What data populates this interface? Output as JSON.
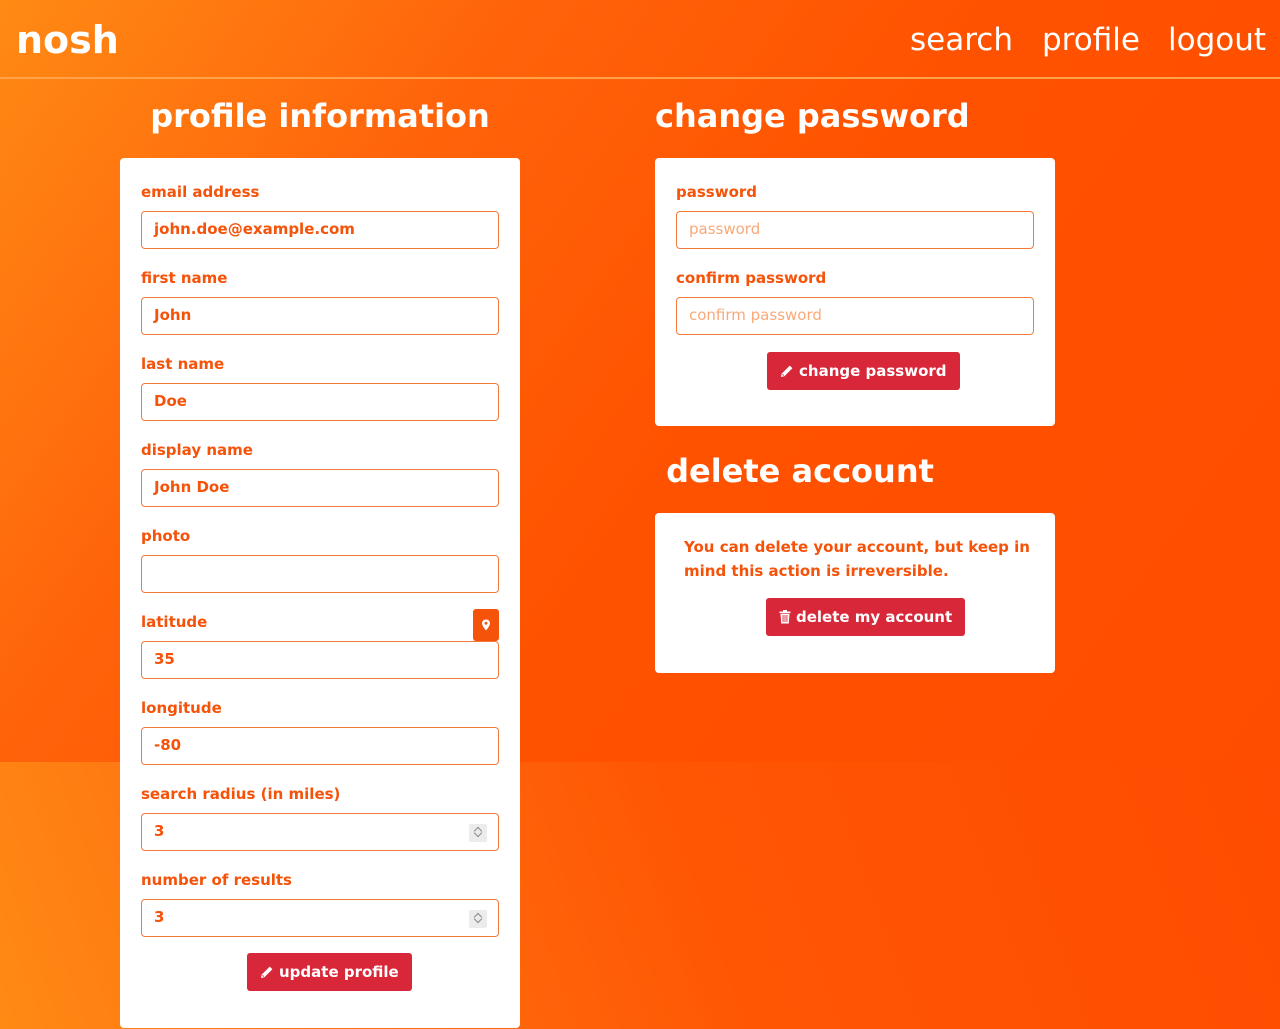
{
  "app": {
    "brand": "nosh"
  },
  "nav": {
    "search": "search",
    "profile": "profile",
    "logout": "logout"
  },
  "profile_section": {
    "title": "profile information",
    "email_label": "email address",
    "email_value": "john.doe@example.com",
    "first_name_label": "first name",
    "first_name_value": "John",
    "last_name_label": "last name",
    "last_name_value": "Doe",
    "display_name_label": "display name",
    "display_name_value": "John Doe",
    "photo_label": "photo",
    "photo_value": "",
    "latitude_label": "latitude",
    "latitude_value": "35",
    "longitude_label": "longitude",
    "longitude_value": "-80",
    "radius_label": "search radius (in miles)",
    "radius_value": "3",
    "results_label": "number of results",
    "results_value": "3",
    "update_button": "update profile"
  },
  "password_section": {
    "title": "change password",
    "password_label": "password",
    "password_placeholder": "password",
    "confirm_label": "confirm password",
    "confirm_placeholder": "confirm password",
    "change_button": "change password"
  },
  "delete_section": {
    "title": "delete account",
    "message": "You can delete your account, but keep in mind this action is irreversible.",
    "delete_button": "delete my account"
  },
  "icons": {
    "brand_color": "#ff5200",
    "accent_text": "#f5520a",
    "button_color": "#d9273a",
    "update_icon": "pencil-icon",
    "change_icon": "pencil-icon",
    "delete_icon": "trash-icon",
    "locate_icon": "map-marker-icon"
  }
}
